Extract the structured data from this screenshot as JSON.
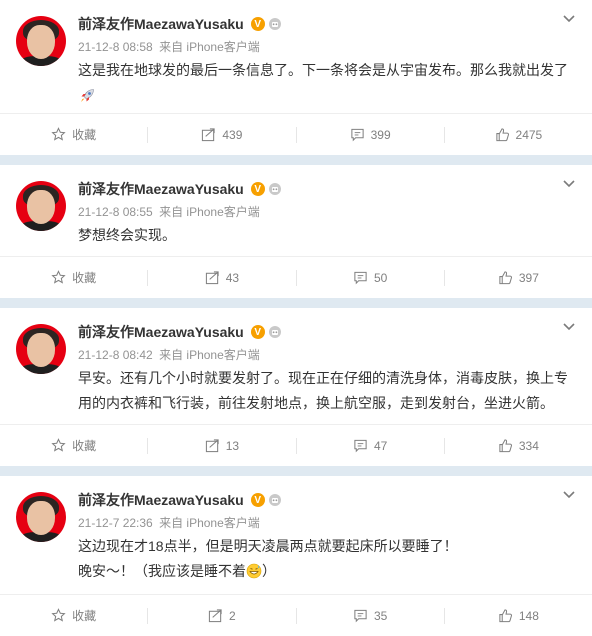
{
  "actions": {
    "favorite_label": "收藏"
  },
  "posts": [
    {
      "author": "前泽友作MaezawaYusaku",
      "verified_badge": "V",
      "time": "21-12-8 08:58",
      "source": "来自 iPhone客户端",
      "lines": [
        "这是我在地球发的最后一条信息了。下一条将会是从宇宙发布。那么我就出发了"
      ],
      "emoji": "rocket-emoji",
      "reposts": "439",
      "comments": "399",
      "likes": "2475"
    },
    {
      "author": "前泽友作MaezawaYusaku",
      "verified_badge": "V",
      "time": "21-12-8 08:55",
      "source": "来自 iPhone客户端",
      "lines": [
        "梦想终会实现。"
      ],
      "reposts": "43",
      "comments": "50",
      "likes": "397"
    },
    {
      "author": "前泽友作MaezawaYusaku",
      "verified_badge": "V",
      "time": "21-12-8 08:42",
      "source": "来自 iPhone客户端",
      "lines": [
        "早安。还有几个小时就要发射了。现在正在仔细的清洗身体，消毒皮肤，换上专",
        "用的内衣裤和飞行装，前往发射地点，换上航空服，走到发射台，坐进火箭。"
      ],
      "reposts": "13",
      "comments": "47",
      "likes": "334"
    },
    {
      "author": "前泽友作MaezawaYusaku",
      "verified_badge": "V",
      "time": "21-12-7 22:36",
      "source": "来自 iPhone客户端",
      "lines": [
        "这边现在才18点半，但是明天凌晨两点就要起床所以要睡了！",
        "晚安～！（我应该是睡不着",
        "）"
      ],
      "emoji": "grinning-sweat-emoji",
      "reposts": "2",
      "comments": "35",
      "likes": "148"
    }
  ]
}
